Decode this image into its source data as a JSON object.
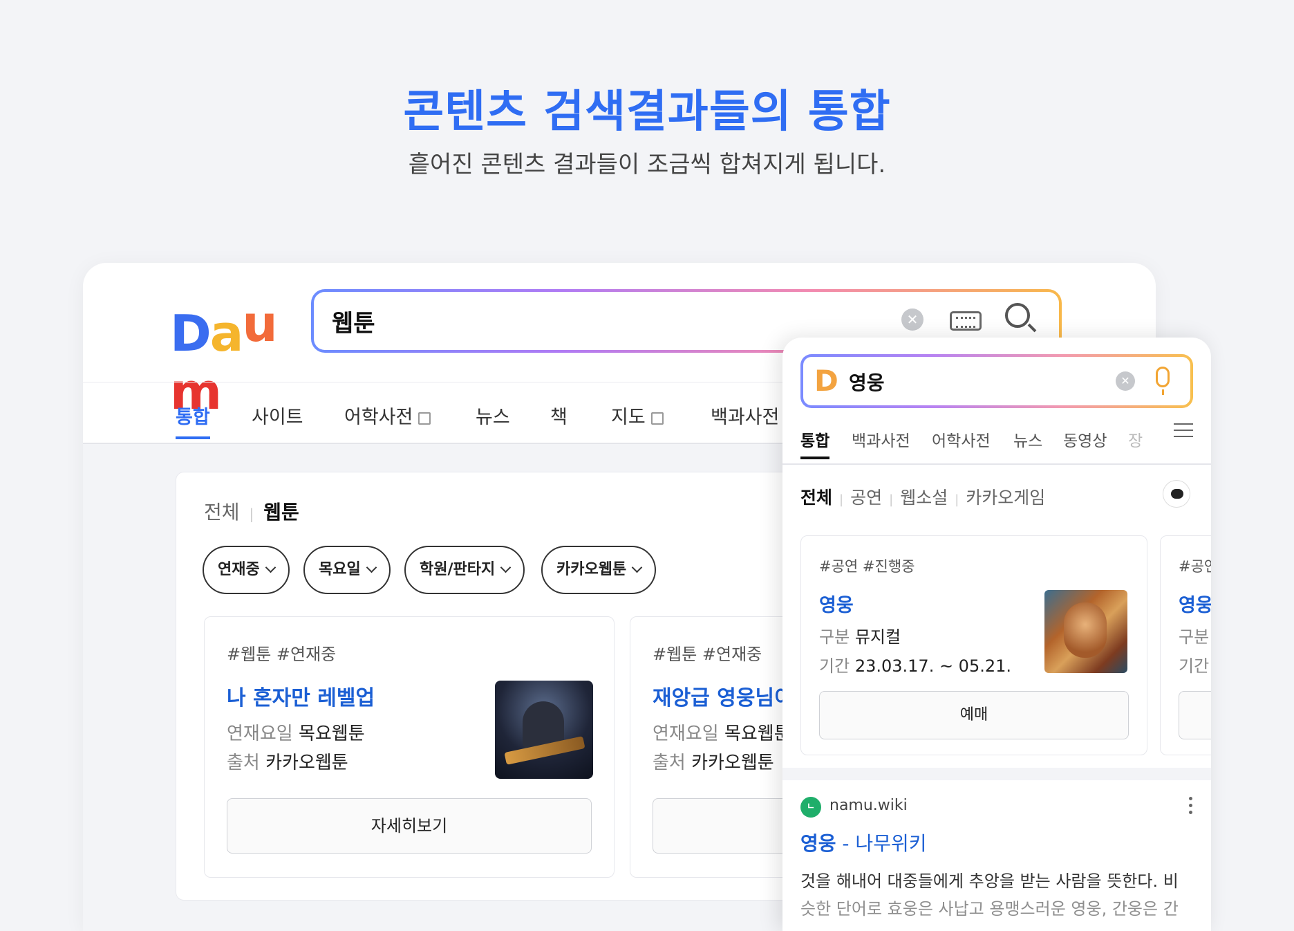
{
  "hero": {
    "title": "콘텐츠 검색결과들의 통합",
    "subtitle": "흩어진 콘텐츠 결과들이 조금씩 합쳐지게 됩니다."
  },
  "desktop": {
    "logo": [
      "D",
      "a",
      "u",
      "m"
    ],
    "logo_colors": [
      "#3a6df0",
      "#f5b52d",
      "#f26b3a",
      "#e7342f"
    ],
    "search_value": "웹툰",
    "tabs": [
      {
        "label": "통합",
        "active": true
      },
      {
        "label": "사이트"
      },
      {
        "label": "어학사전",
        "newwin": true
      },
      {
        "label": "뉴스"
      },
      {
        "label": "책"
      },
      {
        "label": "지도",
        "newwin": true
      },
      {
        "label": "백과사전"
      }
    ],
    "subtabs": [
      {
        "label": "전체"
      },
      {
        "label": "웹툰",
        "active": true
      }
    ],
    "chips": [
      "연재중",
      "목요일",
      "학원/판타지",
      "카카오웹툰"
    ],
    "cards": [
      {
        "tags": "#웹툰 #연재중",
        "title": "나 혼자만 레벨업",
        "row1_label": "연재요일",
        "row1_value": "목요웹툰",
        "row2_label": "출처",
        "row2_value": "카카오웹툰",
        "button": "자세히보기"
      },
      {
        "tags": "#웹툰 #연재중",
        "title": "재앙급 영웅님이",
        "row1_label": "연재요일",
        "row1_value": "목요웹툰",
        "row2_label": "출처",
        "row2_value": "카카오웹툰",
        "button": ""
      }
    ]
  },
  "mobile": {
    "logo": "D",
    "search_value": "영웅",
    "tabs": [
      {
        "label": "통합",
        "active": true
      },
      {
        "label": "백과사전"
      },
      {
        "label": "어학사전"
      },
      {
        "label": "뉴스"
      },
      {
        "label": "동영상"
      },
      {
        "label": "장"
      }
    ],
    "subtabs": [
      "전체",
      "공연",
      "웹소설",
      "카카오게임"
    ],
    "cards": [
      {
        "tags": "#공연 #진행중",
        "title": "영웅",
        "row1_label": "구분",
        "row1_value": "뮤지컬",
        "row2_label": "기간",
        "row2_value": "23.03.17. ~ 05.21.",
        "button": "예매"
      },
      {
        "tags": "#공연",
        "title": "영웅",
        "row1_label": "구분",
        "row2_label": "기간"
      }
    ],
    "result": {
      "site_icon": "ㄴ",
      "site": "namu.wiki",
      "title_em": "영웅",
      "title_rest": " - 나무위키",
      "snippet1": "것을 해내어 대중들에게 추앙을 받는 사람을 뜻한다. 비",
      "snippet2": "슷한 단어로 효웅은 사납고 용맹스러운 영웅, 간웅은 간"
    }
  }
}
